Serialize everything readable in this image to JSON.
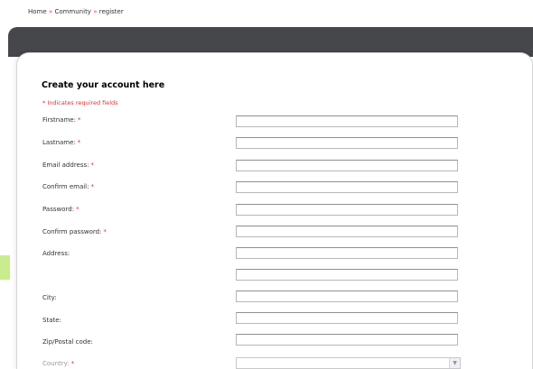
{
  "breadcrumb": {
    "items": [
      "Home",
      "Community",
      "register"
    ],
    "separator": "»"
  },
  "form": {
    "title": "Create your account here",
    "required_note": "* Indicates required fields",
    "required_marker": "*",
    "fields": [
      {
        "label": "Firstname:",
        "required": true,
        "value": ""
      },
      {
        "label": "Lastname:",
        "required": true,
        "value": ""
      },
      {
        "label": "Email address:",
        "required": true,
        "value": ""
      },
      {
        "label": "Confirm email:",
        "required": true,
        "value": ""
      },
      {
        "label": "Password:",
        "required": true,
        "value": ""
      },
      {
        "label": "Confirm password:",
        "required": true,
        "value": ""
      },
      {
        "label": "Address:",
        "required": false,
        "value": ""
      },
      {
        "label": "",
        "required": false,
        "value": ""
      },
      {
        "label": "City:",
        "required": false,
        "value": ""
      },
      {
        "label": "State:",
        "required": false,
        "value": ""
      },
      {
        "label": "Zip/Postal code:",
        "required": false,
        "value": ""
      }
    ],
    "country": {
      "label": "Country:",
      "required": true,
      "selected": "",
      "arrow_icon": "chevron-down-icon"
    }
  },
  "colors": {
    "header_bar": "#45474b",
    "required_red": "#e03030",
    "accent_green": "#c8ec8e"
  }
}
